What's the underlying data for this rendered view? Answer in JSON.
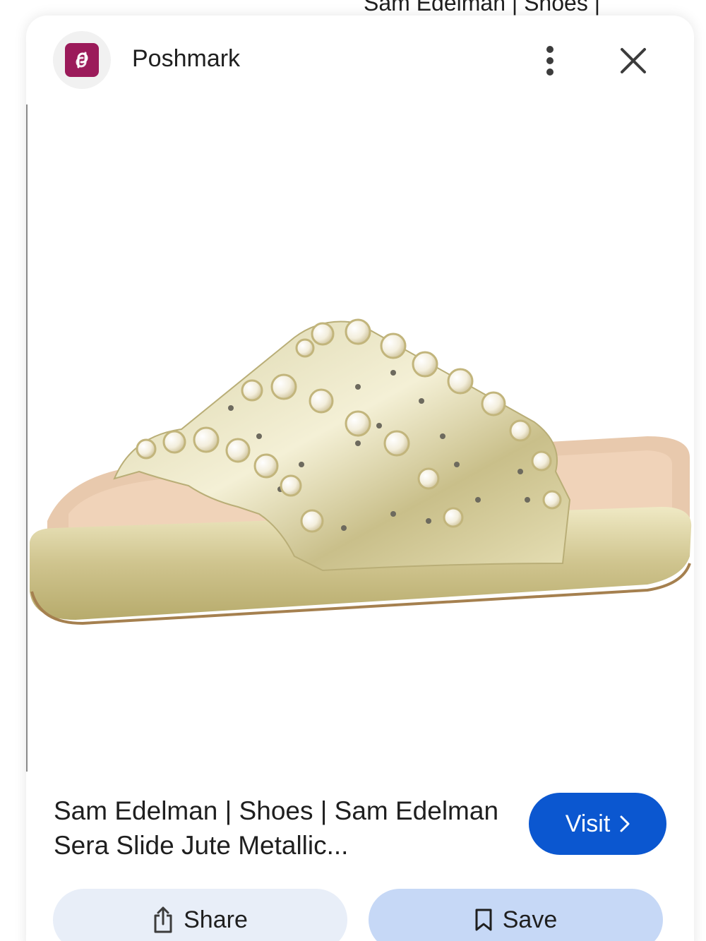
{
  "behind": {
    "text": "Sam Edelman | Shoes |"
  },
  "header": {
    "site_name": "Poshmark",
    "favicon": "poshmark-logo",
    "more_icon": "more-vert-icon",
    "close_icon": "close-icon"
  },
  "image": {
    "subject": "gold-metallic-pearl-slide-sandal"
  },
  "result": {
    "title": "Sam Edelman | Shoes | Sam Edelman Sera Slide Jute Metallic...",
    "visit_label": "Visit"
  },
  "actions": {
    "share_label": "Share",
    "save_label": "Save"
  },
  "colors": {
    "accent": "#0b57d0",
    "share_bg": "#e8eef8",
    "save_bg": "#c6d8f6",
    "favicon_bg": "#9b1b5a"
  }
}
